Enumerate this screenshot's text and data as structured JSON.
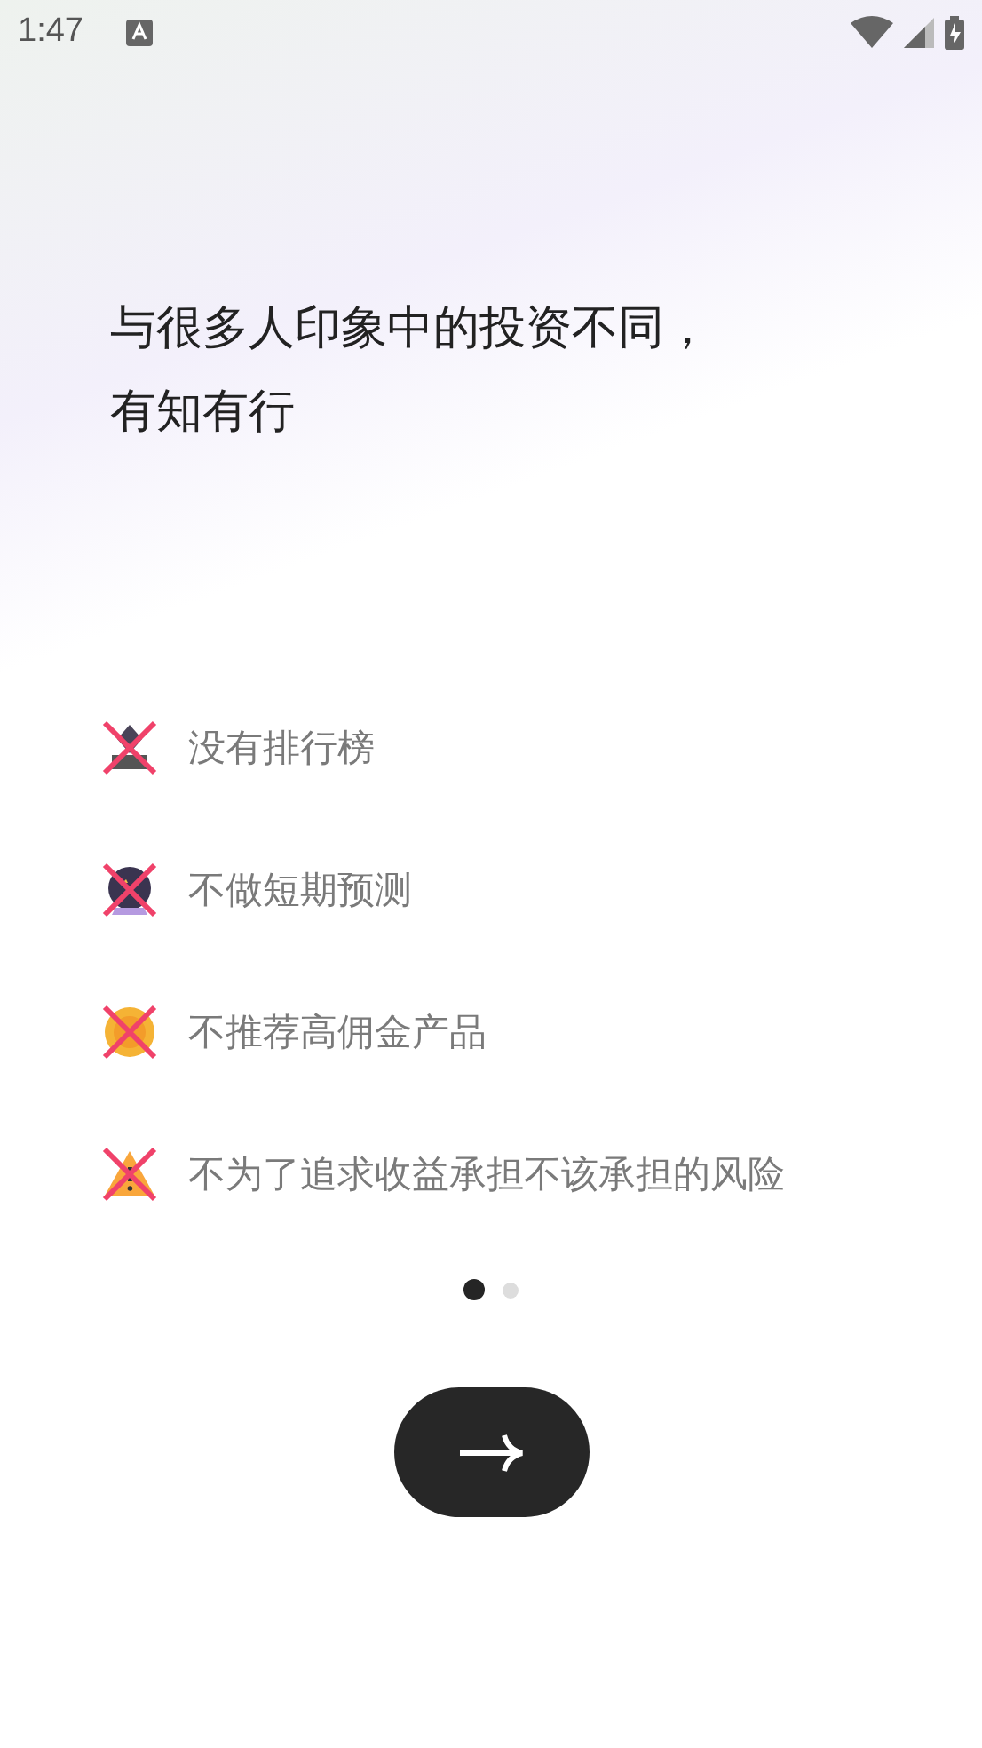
{
  "status_bar": {
    "time": "1:47"
  },
  "heading": [
    "与很多人印象中的投资不同，",
    "有知有行"
  ],
  "points": [
    {
      "kind": "trophy",
      "text": "没有排行榜"
    },
    {
      "kind": "crystal-ball",
      "text": "不做短期预测"
    },
    {
      "kind": "coin",
      "text": "不推荐高佣金产品"
    },
    {
      "kind": "warning",
      "text": "不为了追求收益承担不该承担的风险"
    }
  ],
  "pager": [
    {
      "selected": true
    },
    {
      "selected": false
    }
  ]
}
